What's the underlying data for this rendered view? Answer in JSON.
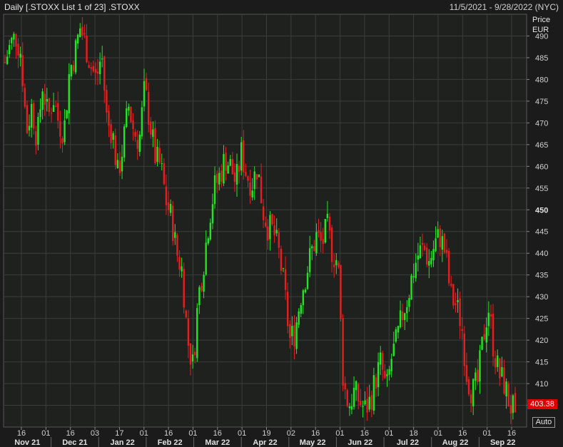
{
  "header": {
    "title": "Daily [.STOXX List 1 of 23] .STOXX",
    "date_range": "11/5/2021 - 9/28/2022 (NYC)"
  },
  "axis": {
    "price_label": "Price",
    "currency_label": "EUR",
    "auto_label": "Auto"
  },
  "last_price": "403.38",
  "colors": {
    "up": "#22e622",
    "down": "#e61e1e",
    "grid": "#3c3c3c",
    "plot_bg": "#1f211f"
  },
  "chart_data": {
    "type": "candlestick",
    "ylim": [
      400,
      495
    ],
    "y_ticks": [
      405,
      410,
      415,
      420,
      425,
      430,
      435,
      440,
      445,
      450,
      455,
      460,
      465,
      470,
      475,
      480,
      485,
      490
    ],
    "y_major": 450,
    "day_ticks": [
      "16",
      "01",
      "16",
      "03",
      "17",
      "01",
      "16",
      "01",
      "16",
      "01",
      "19",
      "02",
      "16",
      "01",
      "16",
      "01",
      "18",
      "01",
      "16",
      "01",
      "16"
    ],
    "month_labels": [
      "Nov 21",
      "Dec 21",
      "Jan 22",
      "Feb 22",
      "Mar 22",
      "Apr 22",
      "May 22",
      "Jun 22",
      "Jul 22",
      "Aug 22",
      "Sep 22"
    ],
    "close_path": [
      484,
      488,
      490,
      486,
      468,
      474,
      466,
      479,
      471,
      476,
      470,
      468,
      482,
      486,
      492,
      488,
      483,
      480,
      486,
      470,
      468,
      458,
      465,
      474,
      468,
      466,
      478,
      470,
      462,
      460,
      452,
      448,
      440,
      436,
      420,
      414,
      430,
      438,
      448,
      455,
      458,
      462,
      460,
      456,
      463,
      458,
      456,
      460,
      450,
      446,
      445,
      440,
      432,
      420,
      422,
      430,
      435,
      440,
      444,
      442,
      446,
      440,
      438,
      410,
      405,
      408,
      406,
      404,
      406,
      411,
      415,
      408,
      416,
      420,
      426,
      430,
      436,
      440,
      441,
      438,
      442,
      444,
      440,
      430,
      428,
      424,
      412,
      408,
      410,
      420,
      428,
      418,
      412,
      410,
      405,
      403.38
    ]
  }
}
